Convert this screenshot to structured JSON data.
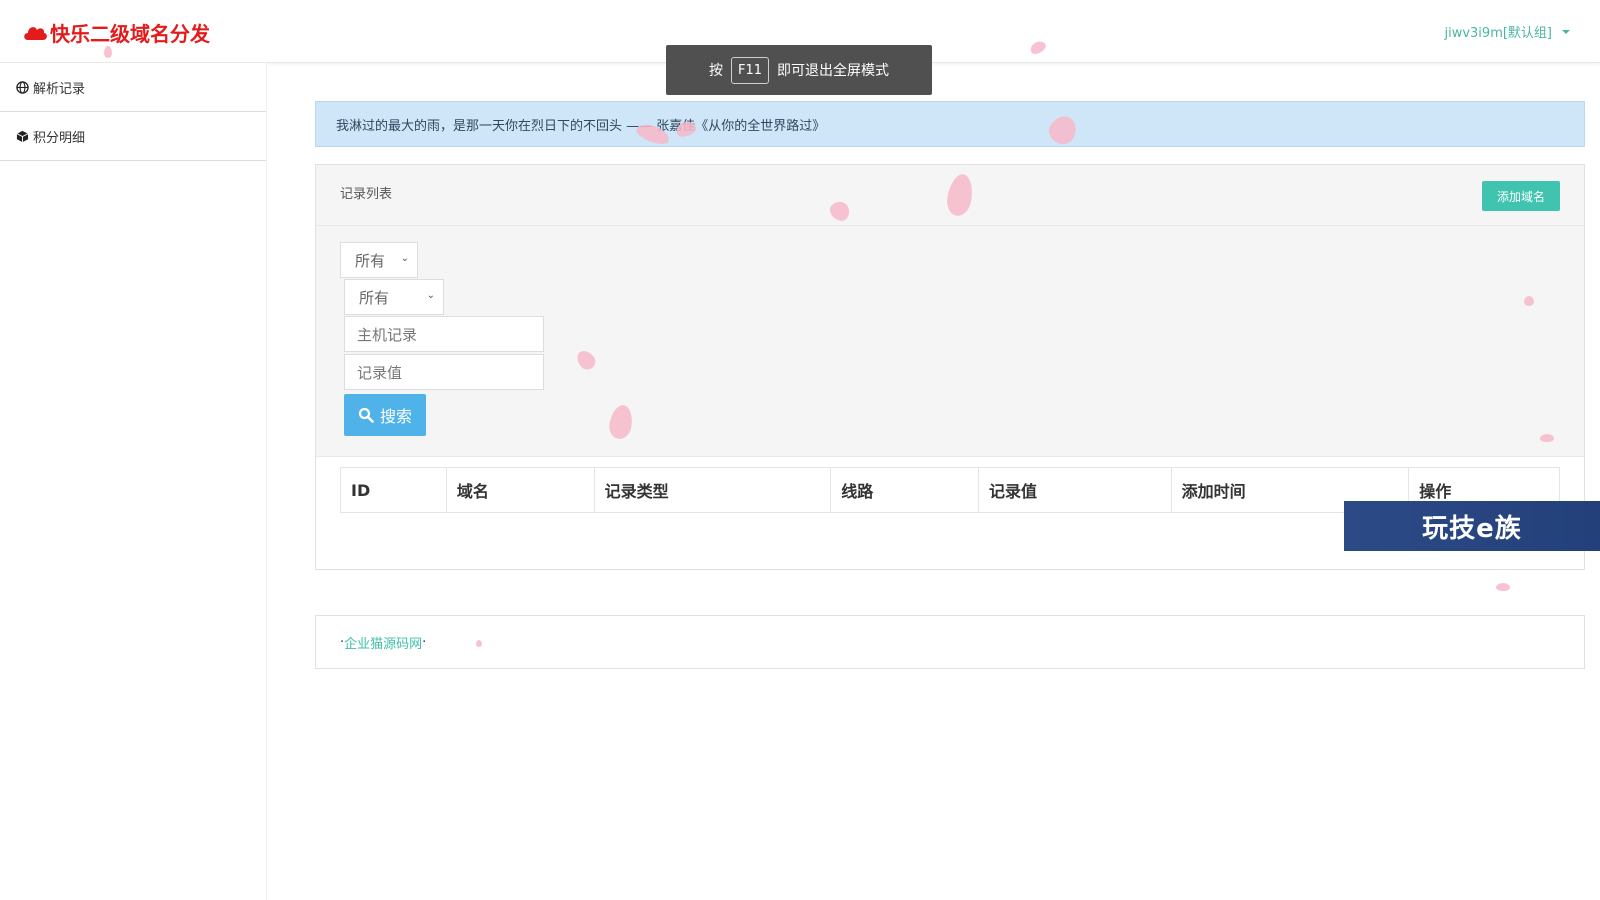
{
  "navbar": {
    "brand": "快乐二级域名分发",
    "brand_color": "#e41b1b",
    "user": "jiwv3i9m[默认组]"
  },
  "toast": {
    "prefix": "按",
    "key": "F11",
    "suffix": "即可退出全屏模式"
  },
  "sidebar": {
    "items": [
      {
        "label": "解析记录",
        "icon": "globe-icon"
      },
      {
        "label": "积分明细",
        "icon": "cube-icon"
      }
    ]
  },
  "quote": "我淋过的最大的雨，是那一天你在烈日下的不回头  —— 张嘉佳《从你的全世界路过》",
  "panel": {
    "title": "记录列表",
    "add_button": "添加域名",
    "filters": {
      "select1": "所有",
      "select2": "所有",
      "host_placeholder": "主机记录",
      "value_placeholder": "记录值",
      "search_button": "搜索"
    },
    "table_headers": [
      "ID",
      "域名",
      "记录类型",
      "线路",
      "记录值",
      "添加时间",
      "操作"
    ]
  },
  "footer": {
    "link": "企业猫源码网"
  },
  "watermark": "玩技e族",
  "colors": {
    "accent": "#40c4b0",
    "search": "#4fb3ea",
    "quote_bg": "#cfe5f8"
  }
}
